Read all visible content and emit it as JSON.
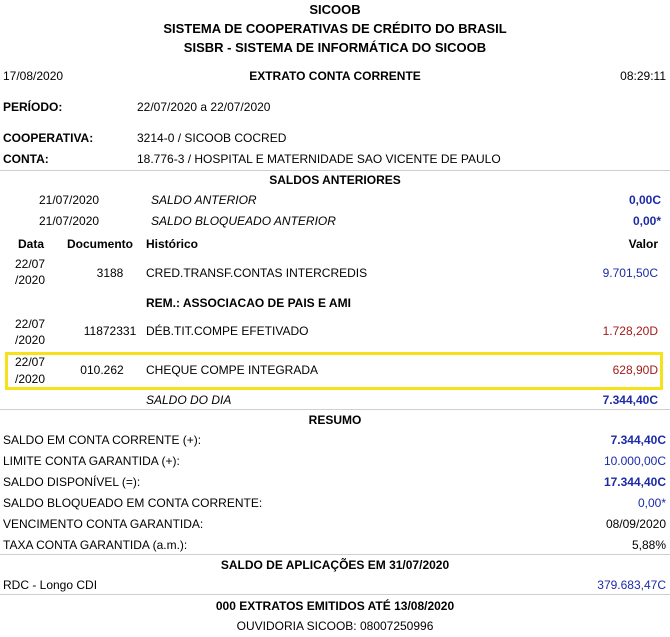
{
  "header": {
    "line1": "SICOOB",
    "line2": "SISTEMA DE COOPERATIVAS DE CRÉDITO DO BRASIL",
    "line3": "SISBR - SISTEMA DE INFORMÁTICA DO SICOOB"
  },
  "top": {
    "date": "17/08/2020",
    "title": "EXTRATO CONTA CORRENTE",
    "time": "08:29:11"
  },
  "info": {
    "periodo_label": "PERÍODO:",
    "periodo_value": "22/07/2020 a 22/07/2020",
    "cooperativa_label": "COOPERATIVA:",
    "cooperativa_value": "3214-0 / SICOOB COCRED",
    "conta_label": "CONTA:",
    "conta_value": "18.776-3 / HOSPITAL E MATERNIDADE SAO VICENTE DE PAULO"
  },
  "saldos_anteriores": {
    "title": "SALDOS ANTERIORES",
    "rows": [
      {
        "date": "21/07/2020",
        "desc": "SALDO ANTERIOR",
        "value": "0,00C"
      },
      {
        "date": "21/07/2020",
        "desc": "SALDO BLOQUEADO ANTERIOR",
        "value": "0,00*"
      }
    ]
  },
  "columns": {
    "data": "Data",
    "documento": "Documento",
    "historico": "Histórico",
    "valor": "Valor"
  },
  "transactions": [
    {
      "date1": "22/07",
      "date2": "/2020",
      "doc": "3188",
      "hist": "CRED.TRANSF.CONTAS INTERCREDIS",
      "value": "9.701,50C"
    },
    {
      "date1": "22/07",
      "date2": "/2020",
      "doc": "11872331",
      "hist": "DÉB.TIT.COMPE EFETIVADO",
      "value": "1.728,20D"
    },
    {
      "date1": "22/07",
      "date2": "/2020",
      "doc": "010.262",
      "hist": "CHEQUE COMPE INTEGRADA",
      "value": "628,90D"
    }
  ],
  "rem": "REM.: ASSOCIACAO DE PAIS E AMI",
  "saldo_dia": {
    "label": "SALDO DO DIA",
    "value": "7.344,40C"
  },
  "resumo": {
    "title": "RESUMO",
    "rows": [
      {
        "label": "SALDO EM CONTA CORRENTE (+):",
        "value": "7.344,40C"
      },
      {
        "label": "LIMITE CONTA GARANTIDA (+):",
        "value": "10.000,00C"
      },
      {
        "label": "SALDO DISPONÍVEL (=):",
        "value": "17.344,40C"
      },
      {
        "label": "SALDO BLOQUEADO EM CONTA CORRENTE:",
        "value": "0,00*"
      },
      {
        "label": "VENCIMENTO CONTA GARANTIDA:",
        "value": "08/09/2020"
      },
      {
        "label": "TAXA CONTA GARANTIDA (a.m.):",
        "value": "5,88%"
      }
    ]
  },
  "aplicacoes": {
    "title": "SALDO DE APLICAÇÕES EM 31/07/2020",
    "rows": [
      {
        "label": "RDC - Longo CDI",
        "value": "379.683,47C"
      }
    ]
  },
  "footer": {
    "extratos": "000 EXTRATOS EMITIDOS ATÉ 13/08/2020",
    "ouvidoria": "OUVIDORIA SICOOB: 08007250996"
  }
}
